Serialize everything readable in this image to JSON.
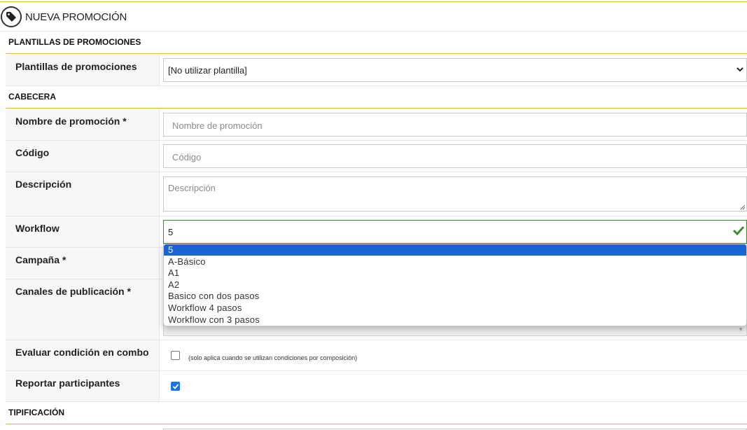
{
  "header": {
    "title": "NUEVA PROMOCIÓN",
    "icon": "tag-icon"
  },
  "sections": {
    "templates": "PLANTILLAS DE PROMOCIONES",
    "head": "CABECERA",
    "typing": "TIPIFICACIÓN"
  },
  "fields": {
    "templates": {
      "label": "Plantillas de promociones",
      "value": "[No utilizar plantilla]"
    },
    "name": {
      "label": "Nombre de promoción *",
      "placeholder": "Nombre de promoción"
    },
    "code": {
      "label": "Código",
      "placeholder": "Código"
    },
    "description": {
      "label": "Descripción",
      "placeholder": "Descripción"
    },
    "workflow": {
      "label": "Workflow",
      "value": "5"
    },
    "campaign": {
      "label": "Campaña *"
    },
    "channels": {
      "label": "Canales de publicación *"
    },
    "combo": {
      "label": "Evaluar condición en combo",
      "note": "(solo aplica cuando se utilizan condiciones por composición)",
      "checked": false
    },
    "participants": {
      "label": "Reportar participantes",
      "checked": true
    }
  },
  "workflow_options": [
    "5",
    "A-Básico",
    "A1",
    "A2",
    "Basico con dos pasos",
    "Workflow 4 pasos",
    "Workflow con 3 pasos"
  ],
  "colors": {
    "accent": "#f0b43c",
    "selected": "#1a63d2",
    "valid": "#3a8a3a",
    "checkbox": "#1a73e8"
  }
}
